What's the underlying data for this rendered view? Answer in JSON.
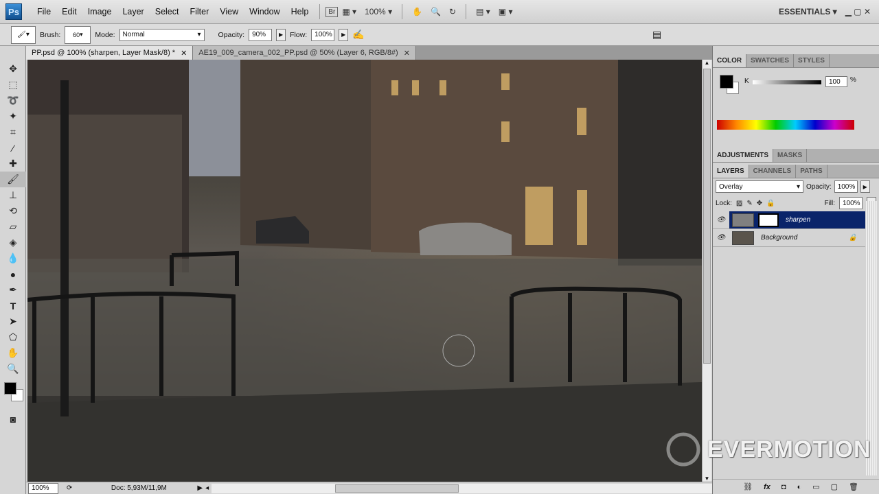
{
  "app": {
    "logo": "Ps",
    "menus": [
      "File",
      "Edit",
      "Image",
      "Layer",
      "Select",
      "Filter",
      "View",
      "Window",
      "Help"
    ],
    "bridge": "Br",
    "zoom": "100%",
    "workspace": "ESSENTIALS"
  },
  "options": {
    "brush_label": "Brush:",
    "brush_size": "60",
    "mode_label": "Mode:",
    "mode": "Normal",
    "opacity_label": "Opacity:",
    "opacity": "90%",
    "flow_label": "Flow:",
    "flow": "100%"
  },
  "tabs": [
    {
      "label": "PP.psd @ 100% (sharpen, Layer Mask/8) *",
      "active": true
    },
    {
      "label": "AE19_009_camera_002_PP.psd @ 50% (Layer 6, RGB/8#)",
      "active": false
    }
  ],
  "color_panel": {
    "tabs": [
      "COLOR",
      "SWATCHES",
      "STYLES"
    ],
    "channel": "K",
    "value": "100",
    "unit": "%"
  },
  "adjust_panel": {
    "tabs": [
      "ADJUSTMENTS",
      "MASKS"
    ]
  },
  "layers_panel": {
    "tabs": [
      "LAYERS",
      "CHANNELS",
      "PATHS"
    ],
    "blend": "Overlay",
    "opacity_label": "Opacity:",
    "opacity": "100%",
    "lock_label": "Lock:",
    "fill_label": "Fill:",
    "fill": "100%",
    "layers": [
      {
        "name": "sharpen",
        "selected": true
      },
      {
        "name": "Background",
        "selected": false
      }
    ]
  },
  "status": {
    "zoom": "100%",
    "doc": "Doc: 5,93M/11,9M"
  },
  "watermark": "EVERMOTION"
}
